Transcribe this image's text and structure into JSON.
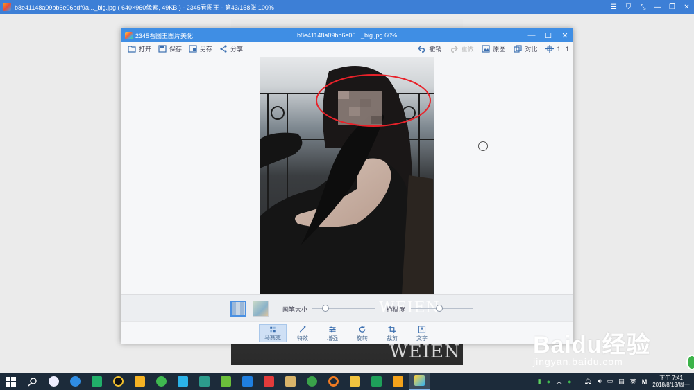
{
  "viewer": {
    "title": "b8e41148a09bb6e06bdf9a..._big.jpg ( 640×960像素, 49KB ) - 2345看图王 - 第43/158张 100%",
    "controls": [
      "☰",
      "⛉",
      "⤡",
      "—",
      "❐",
      "✕"
    ]
  },
  "editor": {
    "app_title": "2345看图王图片美化",
    "file_title": "b8e41148a09bb6e06..._big.jpg   60%",
    "controls": [
      "—",
      "☐",
      "✕"
    ],
    "toolbar": {
      "open": "打开",
      "save": "保存",
      "save_as": "另存",
      "share": "分享",
      "undo": "撤销",
      "redo": "重做",
      "original": "原图",
      "compare": "对比",
      "ratio": "1 : 1"
    },
    "settings": {
      "brush_size_label": "画笔大小",
      "brush_size": 0.22,
      "blur_label": "模糊度",
      "blur": 0.45,
      "photo_watermark": "WEIEN"
    },
    "tools": [
      {
        "label": "马赛克",
        "active": true
      },
      {
        "label": "特效",
        "active": false
      },
      {
        "label": "增强",
        "active": false
      },
      {
        "label": "旋转",
        "active": false
      },
      {
        "label": "裁剪",
        "active": false
      },
      {
        "label": "文字",
        "active": false
      }
    ]
  },
  "background_photo": {
    "watermark": "WEIEN"
  },
  "baidu_watermark": {
    "brand": "Baidu经验",
    "url": "jingyan.baidu.com"
  },
  "taskbar": {
    "ime": "英",
    "time": "下午 7:41",
    "date": "2018/8/13/周一"
  },
  "colors": {
    "title_blue": "#3f8ee4",
    "annotation_red": "#e8222a",
    "taskbar": "#1c2b3a"
  }
}
